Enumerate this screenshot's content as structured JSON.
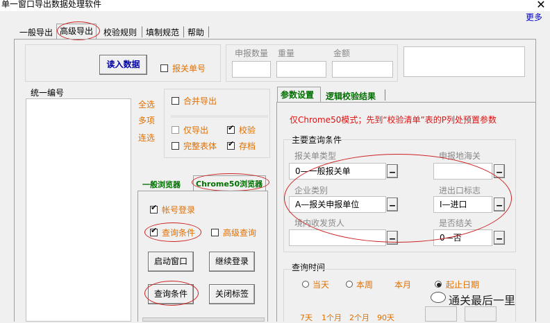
{
  "window": {
    "title": "单一窗口导出数据处理软件",
    "more_label": "更多"
  },
  "tabs": [
    "一般导出",
    "高级导出",
    "校验规则",
    "填制规范",
    "帮助"
  ],
  "read_button": "读入数据",
  "declaration_no": "报关单号",
  "stats": {
    "count_label": "申报数量",
    "weight_label": "重量",
    "amount_label": "金额"
  },
  "unified_no_label": "统一编号",
  "select": {
    "all": "全选",
    "many": "多项",
    "range": "连选"
  },
  "options": {
    "merge_export": "合并导出",
    "export_only": "仅导出",
    "verify": "校验",
    "full_table": "完整表体",
    "archive": "存档"
  },
  "browser_tabs": [
    "一般浏览器",
    "Chrome50浏览器"
  ],
  "browser": {
    "account_login": "帐号登录",
    "query_conditions": "查询条件",
    "advanced_query": "高级查询",
    "start_window": "启动窗口",
    "continue_login": "继续登录",
    "query_button": "查询条件",
    "close_tab": "关闭标签"
  },
  "param_tabs": [
    "参数设置",
    "逻辑校验结果"
  ],
  "notice": "仅Chrome50模式；先到“校验清单”表的P列处预置参数",
  "main_query": {
    "title": "主要查询条件",
    "declaration_type_label": "报关单类型",
    "declaration_type_value": "0—一般报关单",
    "customs_label": "申报地海关",
    "customs_value": "",
    "enterprise_label": "企业类别",
    "enterprise_value": "A—报关申报单位",
    "ie_flag_label": "进出口标志",
    "ie_flag_value": "I—进口",
    "consignee_label": "境内收发货人",
    "consignee_value": "",
    "closed_label": "是否结关",
    "closed_value": "0—否"
  },
  "query_time": {
    "title": "查询时间",
    "today": "当天",
    "this_week": "本周",
    "this_month": "本月",
    "start_date": "起止日期",
    "quick": [
      "7天",
      "1个月",
      "2个月",
      "90天"
    ]
  },
  "watermark": "通关最后一里"
}
